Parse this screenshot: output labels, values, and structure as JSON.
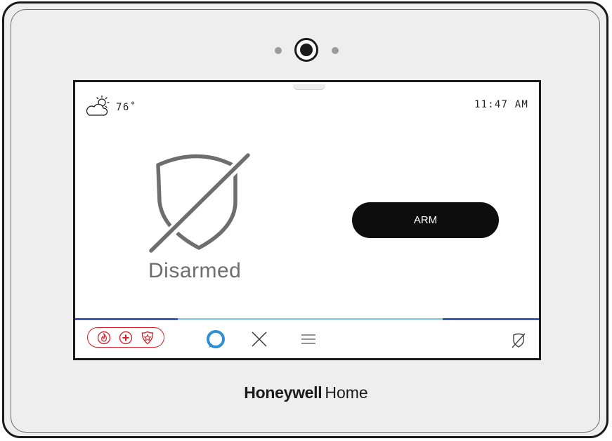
{
  "weather": {
    "icon": "partly-cloudy-icon",
    "temperature": "76˚"
  },
  "clock": {
    "time": "11:47 AM"
  },
  "security": {
    "status": "Disarmed",
    "icon": "shield-disarmed-icon",
    "arm_label": "ARM"
  },
  "emergency": {
    "icons": [
      "fire-icon",
      "medical-icon",
      "police-icon"
    ],
    "color": "#d4202a"
  },
  "nav": {
    "icons": [
      "alexa-ring-icon",
      "tools-x-icon",
      "menu-icon",
      "disarmed-status-icon"
    ]
  },
  "brand": {
    "name_bold": "Honeywell",
    "name_light": "Home"
  },
  "colors": {
    "accent_blue": "#3a5bb3",
    "accent_teal": "#8fd6dc",
    "alexa_blue": "#2f8fd6",
    "arm_button": "#0d0d0d"
  }
}
